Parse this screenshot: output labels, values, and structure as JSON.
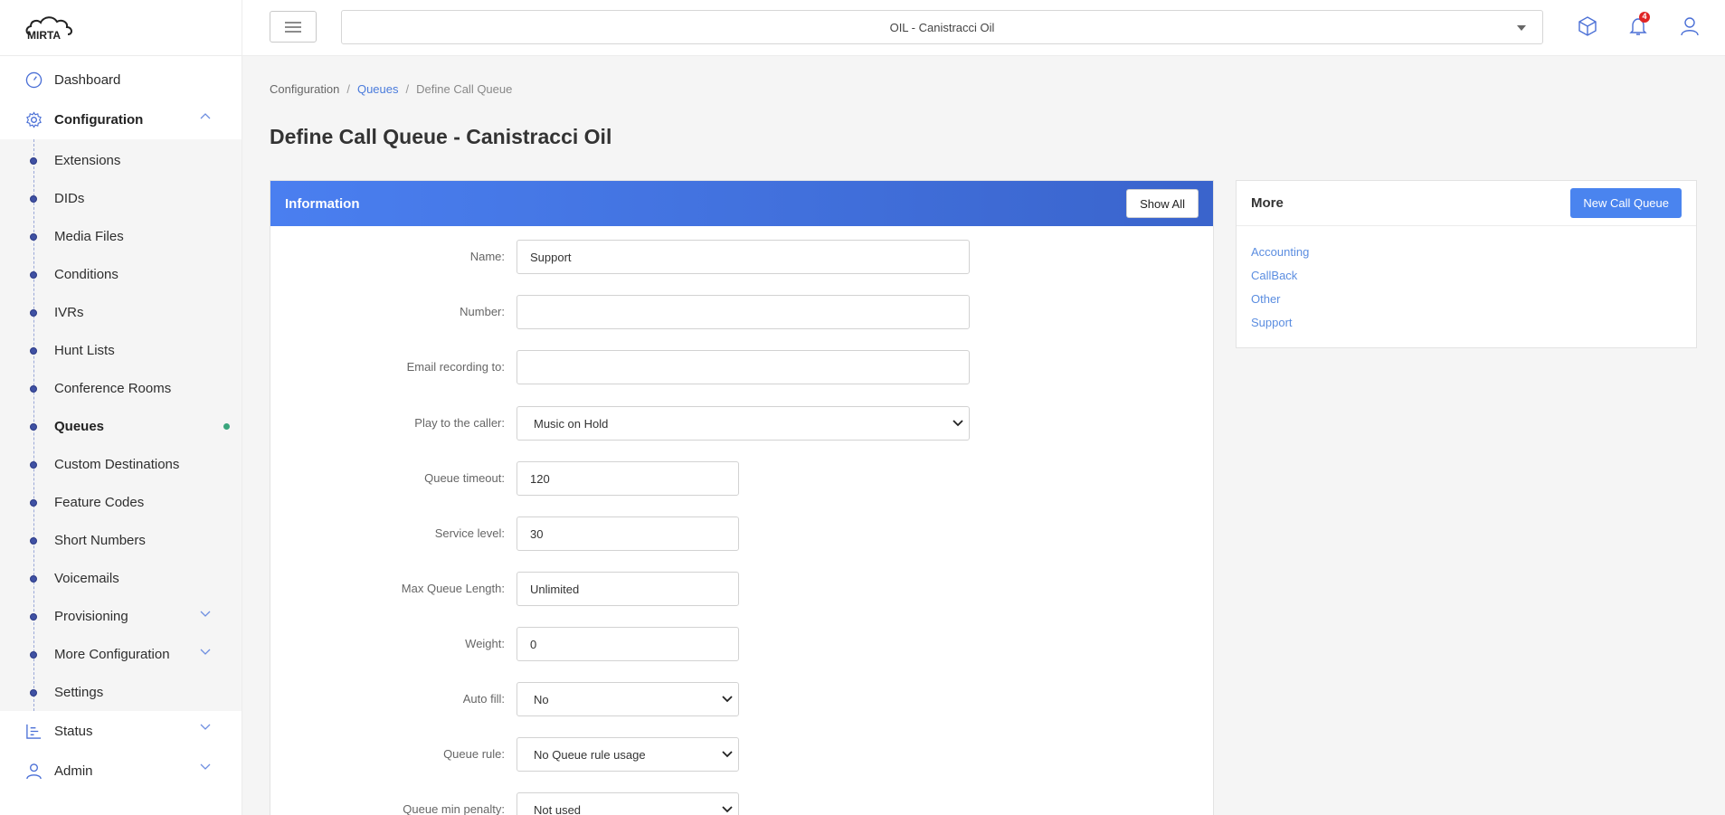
{
  "app": {
    "logo_text": "MIRTA"
  },
  "sidebar": {
    "dashboard": "Dashboard",
    "configuration": "Configuration",
    "config_items": [
      "Extensions",
      "DIDs",
      "Media Files",
      "Conditions",
      "IVRs",
      "Hunt Lists",
      "Conference Rooms",
      "Queues",
      "Custom Destinations",
      "Feature Codes",
      "Short Numbers",
      "Voicemails",
      "Provisioning",
      "More Configuration",
      "Settings"
    ],
    "status": "Status",
    "admin": "Admin"
  },
  "topbar": {
    "tenant": "OIL - Canistracci Oil",
    "notification_count": "4"
  },
  "breadcrumb": {
    "root": "Configuration",
    "queues": "Queues",
    "current": "Define Call Queue"
  },
  "page_title": "Define Call Queue - Canistracci Oil",
  "info": {
    "title": "Information",
    "show_all": "Show All",
    "fields": {
      "name": {
        "label": "Name:",
        "value": "Support"
      },
      "number": {
        "label": "Number:",
        "value": ""
      },
      "email": {
        "label": "Email recording to:",
        "value": ""
      },
      "play": {
        "label": "Play to the caller:",
        "value": "Music on Hold"
      },
      "timeout": {
        "label": "Queue timeout:",
        "value": "120"
      },
      "service": {
        "label": "Service level:",
        "value": "30"
      },
      "maxlen": {
        "label": "Max Queue Length:",
        "value": "Unlimited"
      },
      "weight": {
        "label": "Weight:",
        "value": "0"
      },
      "autofill": {
        "label": "Auto fill:",
        "value": "No"
      },
      "rule": {
        "label": "Queue rule:",
        "value": "No Queue rule usage"
      },
      "minpenalty": {
        "label": "Queue min penalty:",
        "value": "Not used"
      }
    }
  },
  "more": {
    "title": "More",
    "new_button": "New Call Queue",
    "links": [
      "Accounting",
      "CallBack",
      "Other",
      "Support"
    ]
  },
  "colors": {
    "accent": "#4a7ff0",
    "link": "#5b8de0",
    "badge": "#e02424",
    "active_dot": "#3aa57c"
  }
}
